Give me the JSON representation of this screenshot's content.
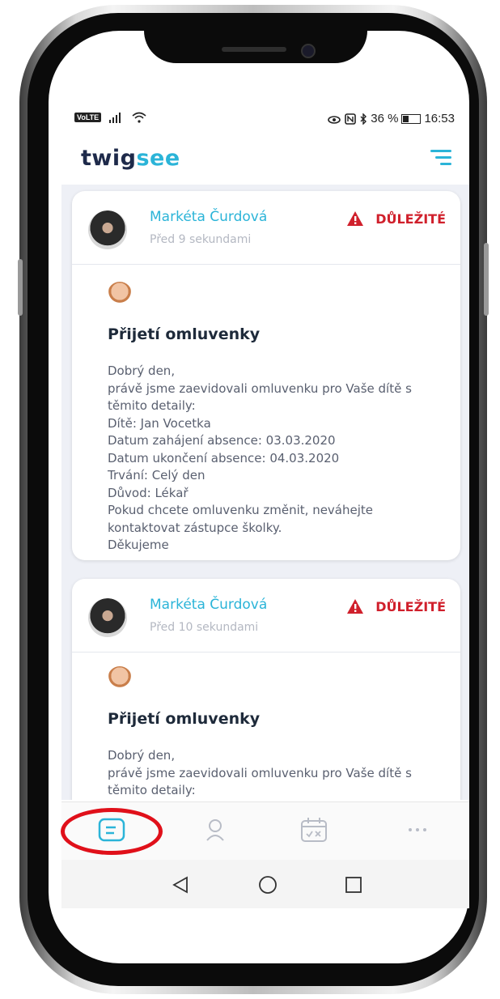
{
  "status_bar": {
    "left_badge": "VoLTE",
    "right_text": "36 %",
    "time": "16:53"
  },
  "header": {
    "brand_part1": "twig",
    "brand_part2": "see",
    "icon": "menu-icon"
  },
  "posts": [
    {
      "author": "Markéta Čurdová",
      "time": "Před 9 sekundami",
      "important_label": "DŮLEŽITÉ",
      "title": "Přijetí omluvenky",
      "body_lines": [
        "Dobrý den,",
        "právě jsme zaevidovali omluvenku pro Vaše dítě s",
        "těmito detaily:",
        "Dítě: Jan Vocetka",
        "Datum zahájení absence: 03.03.2020",
        "Datum ukončení absence: 04.03.2020",
        "Trvání: Celý den",
        "Důvod: Lékař",
        "Pokud chcete omluvenku změnit, neváhejte",
        "kontaktovat zástupce školky.",
        "Děkujeme"
      ]
    },
    {
      "author": "Markéta Čurdová",
      "time": "Před 10 sekundami",
      "important_label": "DŮLEŽITÉ",
      "title": "Přijetí omluvenky",
      "body_lines": [
        "Dobrý den,",
        "právě jsme zaevidovali omluvenku pro Vaše dítě s",
        "těmito detaily:"
      ]
    }
  ],
  "bottom_nav": {
    "items": [
      "feed-icon",
      "profile-icon",
      "calendar-icon",
      "more-icon"
    ],
    "active": "feed-icon"
  },
  "colors": {
    "brand_dark": "#1e2a4a",
    "brand_accent": "#2bb4d8",
    "important_red": "#d0202c",
    "highlight_red": "#e0101a"
  }
}
